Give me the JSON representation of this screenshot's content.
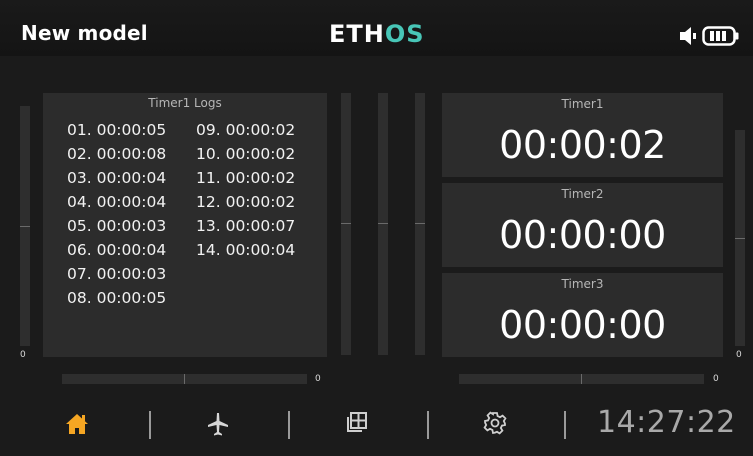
{
  "header": {
    "model_name": "New model",
    "logo": {
      "part1": "ETH",
      "part2": "OS"
    },
    "icons": [
      "speaker-icon",
      "battery-icon"
    ]
  },
  "logs_panel": {
    "title": "Timer1 Logs",
    "column1": [
      "01. 00:00:05",
      "02. 00:00:08",
      "03. 00:00:04",
      "04. 00:00:04",
      "05. 00:00:03",
      "06. 00:00:04",
      "07. 00:00:03",
      "08. 00:00:05"
    ],
    "column2": [
      "09. 00:00:02",
      "10. 00:00:02",
      "11. 00:00:02",
      "12. 00:00:02",
      "13. 00:00:07",
      "14. 00:00:04"
    ]
  },
  "timers": [
    {
      "label": "Timer1",
      "value": "00:00:02"
    },
    {
      "label": "Timer2",
      "value": "00:00:00"
    },
    {
      "label": "Timer3",
      "value": "00:00:00"
    }
  ],
  "sliders": {
    "left_vertical_value": "0",
    "right_vertical_value": "0",
    "left_horizontal_value": "0",
    "right_horizontal_value": "0"
  },
  "nav": {
    "items": [
      "home-icon",
      "airplane-icon",
      "grid-icon",
      "gear-icon"
    ],
    "clock": "14:27:22"
  },
  "colors": {
    "accent_orange": "#f5a623",
    "logo_teal": "#48c6b7",
    "background": "#1b1b1b",
    "panel": "#2c2c2c"
  }
}
